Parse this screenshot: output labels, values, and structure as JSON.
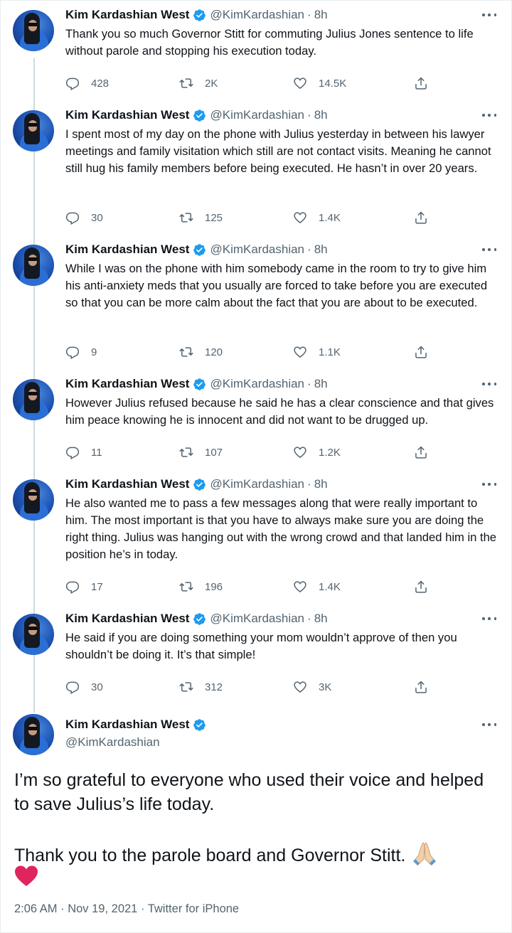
{
  "author": {
    "name": "Kim Kardashian West",
    "handle": "@KimKardashian"
  },
  "colors": {
    "verified": "#1d9bf0",
    "text": "#0f1419",
    "muted": "#536471",
    "heart": "#e0245e"
  },
  "tweets": [
    {
      "time": "8h",
      "text": "Thank you so much Governor Stitt for commuting Julius Jones sentence to life without parole and stopping his execution today.",
      "replies": "428",
      "retweets": "2K",
      "likes": "14.5K"
    },
    {
      "time": "8h",
      "text": "I spent most of my day on the phone with Julius yesterday in between his lawyer meetings and family visitation which still are not contact visits. Meaning he cannot still hug his family members before being executed. He hasn’t in over 20 years.",
      "replies": "30",
      "retweets": "125",
      "likes": "1.4K"
    },
    {
      "time": "8h",
      "text": "While I was on the phone with him somebody came in the room to try to give him his anti-anxiety meds that you usually are forced to take before you are executed so that you can be more calm about the fact that you are about to be executed.",
      "replies": "9",
      "retweets": "120",
      "likes": "1.1K"
    },
    {
      "time": "8h",
      "text": "However Julius refused because he said he has a clear conscience and that gives him peace knowing he is innocent and did not want to be drugged up.",
      "replies": "11",
      "retweets": "107",
      "likes": "1.2K"
    },
    {
      "time": "8h",
      "text": "He also wanted me to pass a few messages along that were really important to him. The most important is that you have to always make sure you are doing the right thing. Julius was hanging out with the wrong crowd and that landed him in the position he’s in today.",
      "replies": "17",
      "retweets": "196",
      "likes": "1.4K"
    },
    {
      "time": "8h",
      "text": "He said if you are doing something your mom wouldn’t approve of then you shouldn’t be doing it. It’s that simple!",
      "replies": "30",
      "retweets": "312",
      "likes": "3K"
    }
  ],
  "main_tweet": {
    "paragraph1": "I’m so grateful to everyone who used their voice and helped to save Julius’s life today.",
    "paragraph2": "Thank you to the parole board and Governor Stitt.",
    "footer": "2:06 AM · Nov 19, 2021 · Twitter for iPhone"
  }
}
